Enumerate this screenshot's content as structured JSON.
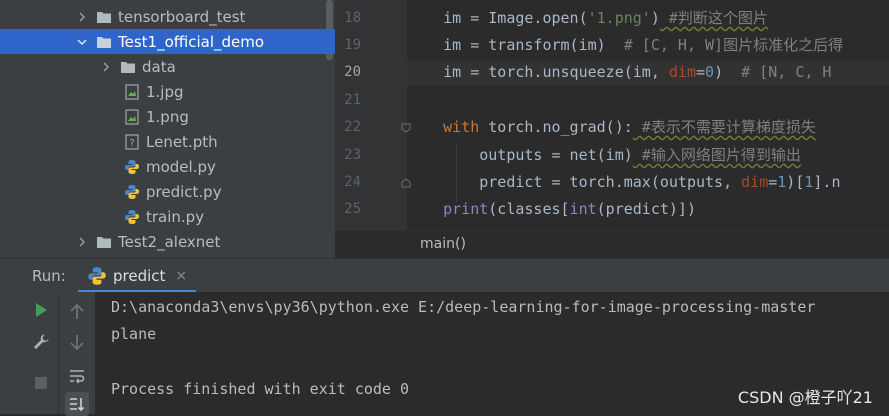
{
  "project_tree": {
    "items": [
      {
        "label": "tensorboard_test",
        "type": "folder",
        "expanded": false,
        "selected": false
      },
      {
        "label": "Test1_official_demo",
        "type": "folder",
        "expanded": true,
        "selected": true
      },
      {
        "label": "data",
        "type": "folder",
        "expanded": false,
        "selected": false
      },
      {
        "label": "1.jpg",
        "type": "image",
        "selected": false
      },
      {
        "label": "1.png",
        "type": "image",
        "selected": false
      },
      {
        "label": "Lenet.pth",
        "type": "unknown",
        "selected": false
      },
      {
        "label": "model.py",
        "type": "python",
        "selected": false
      },
      {
        "label": "predict.py",
        "type": "python",
        "selected": false
      },
      {
        "label": "train.py",
        "type": "python",
        "selected": false
      },
      {
        "label": "Test2_alexnet",
        "type": "folder",
        "expanded": false,
        "selected": false
      }
    ]
  },
  "editor": {
    "current_line": "20",
    "lines": [
      {
        "num": "18"
      },
      {
        "num": "19"
      },
      {
        "num": "20"
      },
      {
        "num": "21"
      },
      {
        "num": "22"
      },
      {
        "num": "23"
      },
      {
        "num": "24"
      },
      {
        "num": "25"
      }
    ],
    "code": {
      "l18_a": "    im = Image.open(",
      "l18_str": "'1.png'",
      "l18_b": ")",
      "l18_cmt": " #判断这个图片",
      "l19_a": "    im = transform(im)  ",
      "l19_cmt": "# [C, H, W]图片标准化之后得",
      "l20_a": "    im = torch.unsqueeze(im, ",
      "l20_param": "dim",
      "l20_eq": "=",
      "l20_num": "0",
      "l20_b": ")  ",
      "l20_cmt": "# [N, C, H",
      "l22_kw": "    with ",
      "l22_a": "torch.no_grad():",
      "l22_cmt": " #表示不需要计算梯度损失",
      "l23_a": "        outputs = net(im)",
      "l23_cmt": " #输入网络图片得到输出",
      "l24_a": "        predict = torch.max(outputs, ",
      "l24_param": "dim",
      "l24_eq": "=",
      "l24_num": "1",
      "l24_b": ")[",
      "l24_num2": "1",
      "l24_c": "].n",
      "l25_builtin": "    print",
      "l25_a": "(classes[",
      "l25_builtin2": "int",
      "l25_b": "(predict)])"
    },
    "breadcrumb": "main()"
  },
  "run_panel": {
    "label": "Run:",
    "tab_label": "predict",
    "tab_close": "×",
    "console_lines": [
      "D:\\anaconda3\\envs\\py36\\python.exe E:/deep-learning-for-image-processing-master",
      "plane",
      "",
      "Process finished with exit code 0"
    ]
  },
  "watermark": "CSDN @橙子吖21",
  "colors": {
    "selection": "#2f65ca",
    "run_green": "#499c54",
    "tab_underline": "#4a88c7"
  }
}
